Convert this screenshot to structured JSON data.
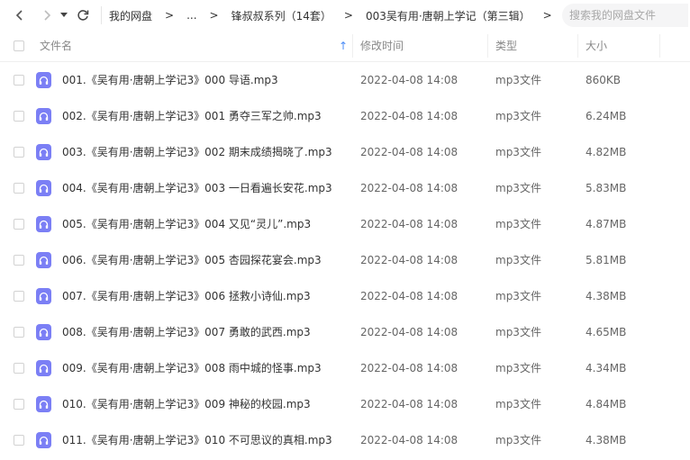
{
  "toolbar": {
    "breadcrumbs": [
      "我的网盘",
      "...",
      "锋叔叔系列（14套）",
      "003吴有用·唐朝上学记（第三辑）"
    ],
    "search_placeholder": "搜索我的网盘文件"
  },
  "columns": {
    "name": "文件名",
    "modified": "修改时间",
    "type": "类型",
    "size": "大小"
  },
  "colors": {
    "accent": "#4a8cf7",
    "audio_icon": "#7b7ff5"
  },
  "files": [
    {
      "name": "001.《吴有用·唐朝上学记3》000 导语.mp3",
      "modified": "2022-04-08 14:08",
      "type": "mp3文件",
      "size": "860KB",
      "icon": "headphones-icon"
    },
    {
      "name": "002.《吴有用·唐朝上学记3》001 勇夺三军之帅.mp3",
      "modified": "2022-04-08 14:08",
      "type": "mp3文件",
      "size": "6.24MB",
      "icon": "headphones-icon"
    },
    {
      "name": "003.《吴有用·唐朝上学记3》002 期末成绩揭晓了.mp3",
      "modified": "2022-04-08 14:08",
      "type": "mp3文件",
      "size": "4.82MB",
      "icon": "headphones-icon"
    },
    {
      "name": "004.《吴有用·唐朝上学记3》003 一日看遍长安花.mp3",
      "modified": "2022-04-08 14:08",
      "type": "mp3文件",
      "size": "5.83MB",
      "icon": "headphones-icon"
    },
    {
      "name": "005.《吴有用·唐朝上学记3》004 又见“灵儿”.mp3",
      "modified": "2022-04-08 14:08",
      "type": "mp3文件",
      "size": "4.87MB",
      "icon": "headphones-icon"
    },
    {
      "name": "006.《吴有用·唐朝上学记3》005 杏园探花宴会.mp3",
      "modified": "2022-04-08 14:08",
      "type": "mp3文件",
      "size": "5.81MB",
      "icon": "headphones-icon"
    },
    {
      "name": "007.《吴有用·唐朝上学记3》006 拯救小诗仙.mp3",
      "modified": "2022-04-08 14:08",
      "type": "mp3文件",
      "size": "4.38MB",
      "icon": "headphones-icon"
    },
    {
      "name": "008.《吴有用·唐朝上学记3》007 勇敢的武西.mp3",
      "modified": "2022-04-08 14:08",
      "type": "mp3文件",
      "size": "4.65MB",
      "icon": "headphones-icon"
    },
    {
      "name": "009.《吴有用·唐朝上学记3》008 雨中城的怪事.mp3",
      "modified": "2022-04-08 14:08",
      "type": "mp3文件",
      "size": "4.34MB",
      "icon": "headphones-icon"
    },
    {
      "name": "010.《吴有用·唐朝上学记3》009 神秘的校园.mp3",
      "modified": "2022-04-08 14:08",
      "type": "mp3文件",
      "size": "4.84MB",
      "icon": "headphones-icon"
    },
    {
      "name": "011.《吴有用·唐朝上学记3》010 不可思议的真相.mp3",
      "modified": "2022-04-08 14:08",
      "type": "mp3文件",
      "size": "4.38MB",
      "icon": "headphones-icon"
    }
  ]
}
